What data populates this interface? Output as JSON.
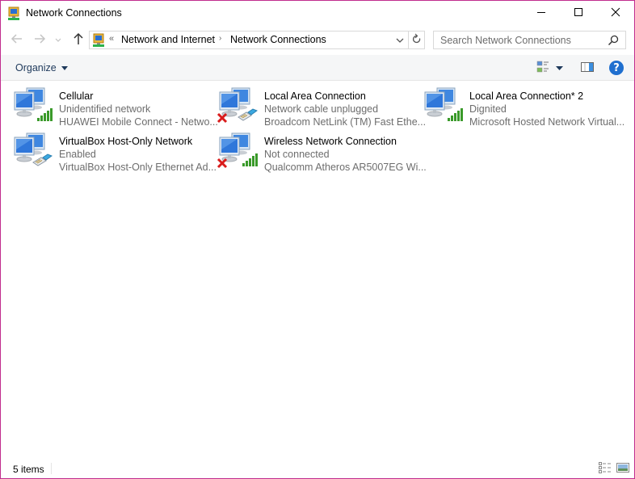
{
  "window": {
    "title": "Network Connections",
    "icon": "network-connections-icon",
    "controls": {
      "minimize": "minimize-icon",
      "maximize": "maximize-icon",
      "close": "close-icon"
    },
    "border_color": "#c12c8e"
  },
  "nav": {
    "back_icon": "arrow-left-icon",
    "forward_icon": "arrow-right-icon",
    "recent_icon": "chevron-down-icon",
    "up_icon": "arrow-up-icon",
    "address": {
      "overflow": "«",
      "crumbs": [
        "Network and Internet",
        "Network Connections"
      ],
      "separator": "›",
      "dropdown_icon": "chevron-down-icon",
      "refresh_icon": "refresh-icon"
    },
    "search": {
      "placeholder": "Search Network Connections",
      "value": "",
      "icon": "search-icon"
    }
  },
  "commandbar": {
    "organize_label": "Organize",
    "views_icon": "change-view-icon",
    "views_dropdown_icon": "caret-down-icon",
    "preview_pane_icon": "preview-pane-icon",
    "help_label": "?"
  },
  "connections": [
    {
      "name": "Cellular",
      "status": "Unidentified network",
      "device": "HUAWEI Mobile Connect - Netwo...",
      "type": "signal",
      "disabled": false
    },
    {
      "name": "Local Area Connection",
      "status": "Network cable unplugged",
      "device": "Broadcom NetLink (TM) Fast Ethe...",
      "type": "ethernet",
      "disabled": true
    },
    {
      "name": "Local Area Connection* 2",
      "status": "Dignited",
      "device": "Microsoft Hosted Network Virtual...",
      "type": "signal",
      "disabled": false
    },
    {
      "name": "VirtualBox Host-Only Network",
      "status": "Enabled",
      "device": "VirtualBox Host-Only Ethernet Ad...",
      "type": "ethernet",
      "disabled": false
    },
    {
      "name": "Wireless Network Connection",
      "status": "Not connected",
      "device": "Qualcomm Atheros AR5007EG Wi...",
      "type": "signal",
      "disabled": true
    }
  ],
  "statusbar": {
    "item_count": "5 items",
    "details_view_icon": "details-view-icon",
    "large_icons_view_icon": "large-icons-view-icon"
  },
  "colors": {
    "accent": "#1f6fcf",
    "secondary_text": "#6d6d6d",
    "signal_green": "#3a9a2a",
    "error_red": "#d91c1c"
  }
}
